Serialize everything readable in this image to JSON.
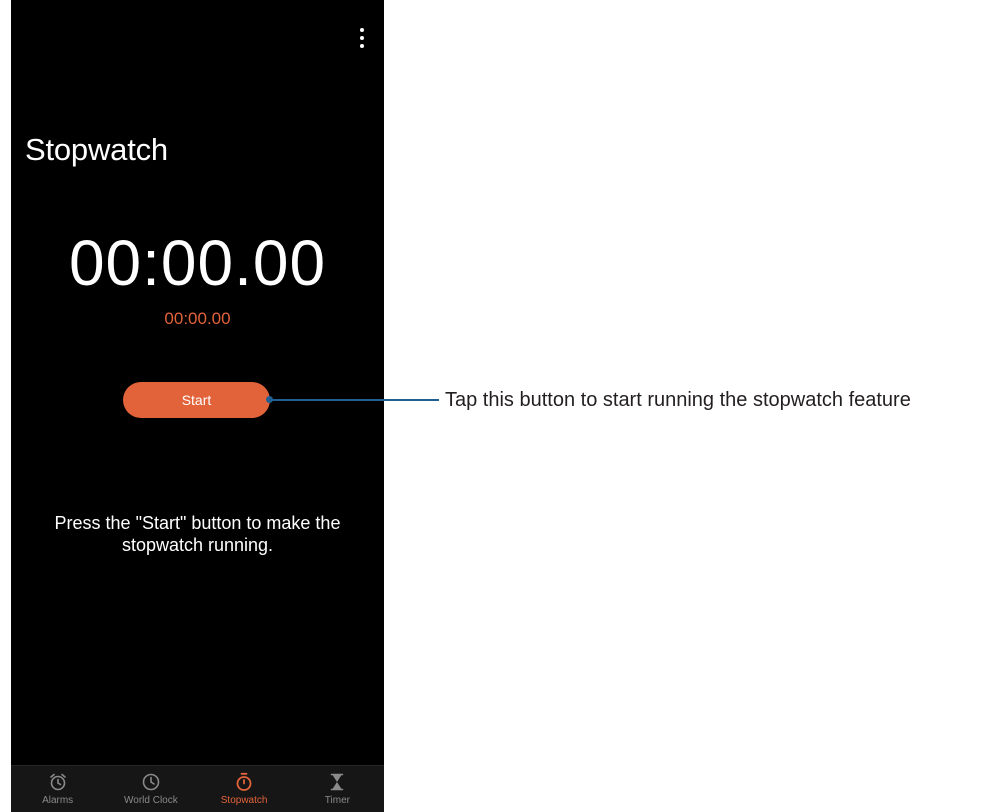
{
  "stopwatch": {
    "title": "Stopwatch",
    "main_time": "00:00.00",
    "lap_time": "00:00.00",
    "start_label": "Start",
    "hint_line1": "Press the \"Start\" button to make the",
    "hint_line2": "stopwatch running."
  },
  "nav": {
    "items": [
      {
        "label": "Alarms",
        "icon": "alarm-icon",
        "active": false
      },
      {
        "label": "World Clock",
        "icon": "clock-icon",
        "active": false
      },
      {
        "label": "Stopwatch",
        "icon": "stopwatch-icon",
        "active": true
      },
      {
        "label": "Timer",
        "icon": "hourglass-icon",
        "active": false
      }
    ]
  },
  "annotation": {
    "text": "Tap this button to start running the stopwatch feature"
  },
  "colors": {
    "accent": "#e2633a",
    "background": "#000000",
    "nav_inactive": "#8a8a8a",
    "callout": "#1f5f94"
  }
}
